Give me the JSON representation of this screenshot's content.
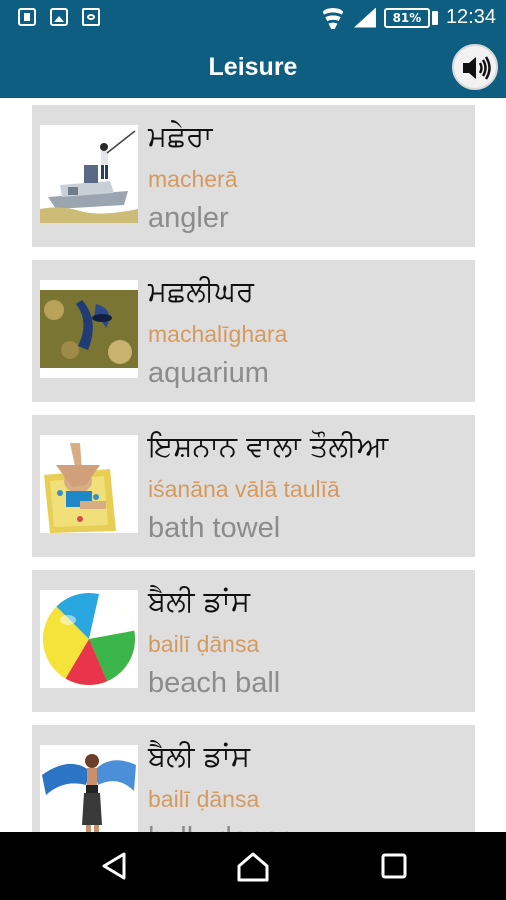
{
  "status_bar": {
    "battery": "81%",
    "time": "12:34",
    "icons": [
      "sim-card-icon",
      "image-icon",
      "app-notification-icon",
      "wifi-icon",
      "signal-icon",
      "battery-icon"
    ]
  },
  "app_bar": {
    "title": "Leisure",
    "speaker_icon": "speaker-icon"
  },
  "items": [
    {
      "punjabi": "ਮਛੇਰਾ",
      "translit": "macherā",
      "english": "angler",
      "image": "angler-boat"
    },
    {
      "punjabi": "ਮਛਲੀਘਰ",
      "translit": "machalīghara",
      "english": "aquarium",
      "image": "aquarium-fish"
    },
    {
      "punjabi": "ਇਸ਼ਨਾਨ ਵਾਲਾ ਤੌਲੀਆ",
      "translit": "iśanāna vālā taulīā",
      "english": "bath towel",
      "image": "bath-towel"
    },
    {
      "punjabi": "ਬੈਲੀ ਡਾਂਸ",
      "translit": "bailī ḍānsa",
      "english": "beach ball",
      "image": "beach-ball"
    },
    {
      "punjabi": "ਬੈਲੀ ਡਾਂਸ",
      "translit": "bailī ḍānsa",
      "english": "belly dance",
      "image": "belly-dancer"
    }
  ],
  "nav": {
    "back_icon": "back-icon",
    "home_icon": "home-icon",
    "recents_icon": "recents-icon"
  }
}
